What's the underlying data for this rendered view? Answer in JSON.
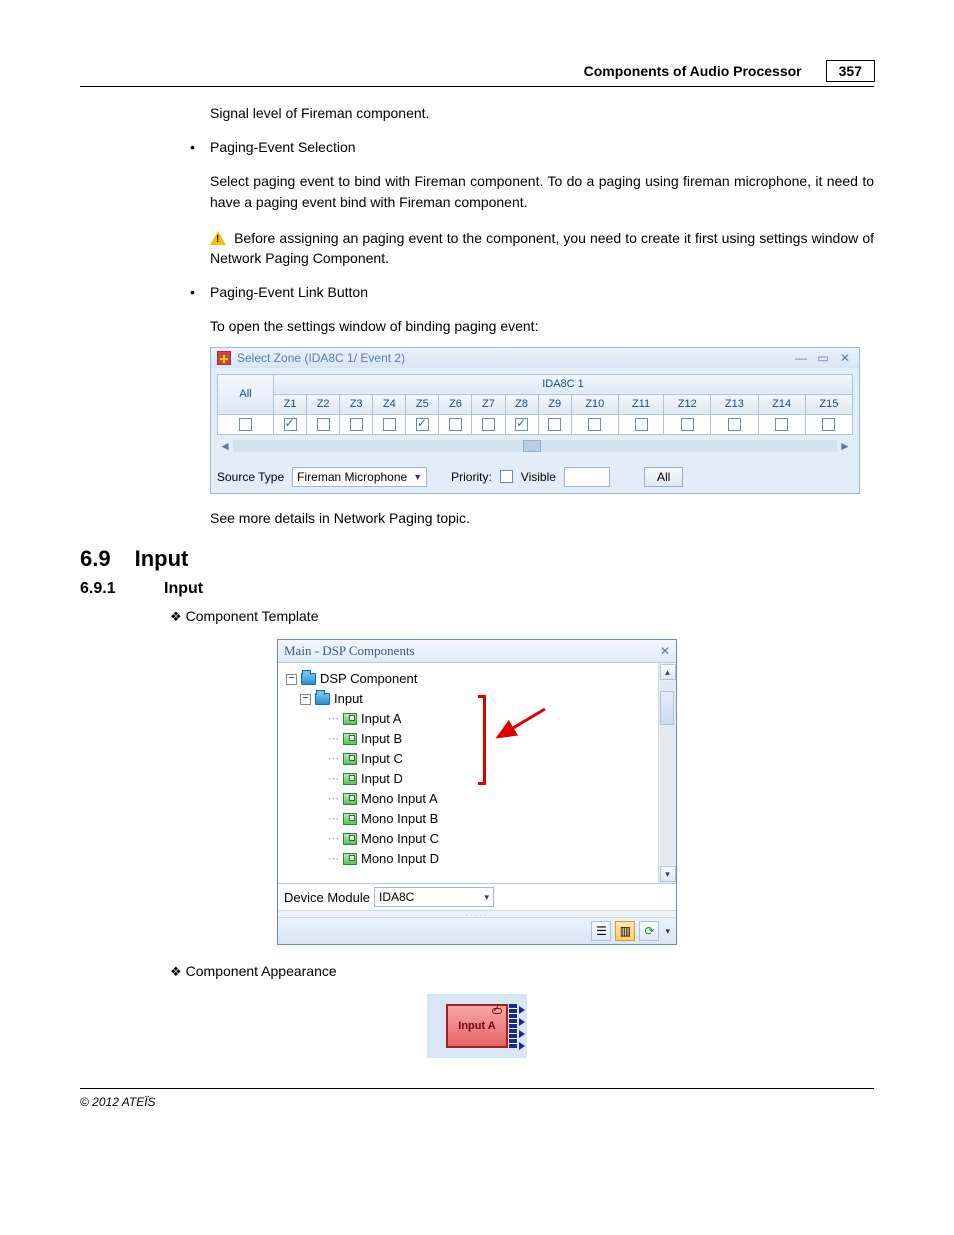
{
  "header": {
    "title": "Components of Audio Processor",
    "page": "357"
  },
  "intro": {
    "text": "Signal level of Fireman component."
  },
  "bullet1": {
    "title": "Paging-Event Selection",
    "p1": "Select paging event to bind with Fireman component. To do a paging using fireman microphone, it need to have a paging event bind with Fireman component.",
    "warn": "Before assigning an paging event to the component, you need to create it first using settings window of Network Paging Component."
  },
  "bullet2": {
    "title": "Paging-Event Link Button",
    "p1": "To open the settings window of binding paging event:"
  },
  "selectZone": {
    "title": "Select Zone (IDA8C 1/ Event 2)",
    "group": "IDA8C 1",
    "allLabel": "All",
    "cols": [
      "Z1",
      "Z2",
      "Z3",
      "Z4",
      "Z5",
      "Z6",
      "Z7",
      "Z8",
      "Z9",
      "Z10",
      "Z11",
      "Z12",
      "Z13",
      "Z14",
      "Z15"
    ],
    "checked": {
      "all": false,
      "z": [
        true,
        false,
        false,
        false,
        true,
        false,
        false,
        true,
        false,
        false,
        false,
        false,
        false,
        false,
        false
      ]
    },
    "sourceTypeLabel": "Source Type",
    "sourceTypeValue": "Fireman Microphone",
    "priorityLabel": "Priority:",
    "visibleLabel": "Visible",
    "allBtn": "All"
  },
  "afterWindow": "See more details in Network Paging topic.",
  "sec": {
    "num": "6.9",
    "title": "Input"
  },
  "subsec": {
    "num": "6.9.1",
    "title": "Input"
  },
  "compTemplate": "Component Template",
  "dsp": {
    "title": "Main - DSP Components",
    "root": "DSP Component",
    "inputFolder": "Input",
    "items": [
      "Input A",
      "Input B",
      "Input C",
      "Input D",
      "Mono Input A",
      "Mono Input B",
      "Mono Input C",
      "Mono Input D"
    ],
    "deviceLabel": "Device Module",
    "deviceValue": "IDA8C"
  },
  "compAppearance": "Component Appearance",
  "inputA": {
    "label": "Input A"
  },
  "footer": "© 2012 ATEÏS"
}
